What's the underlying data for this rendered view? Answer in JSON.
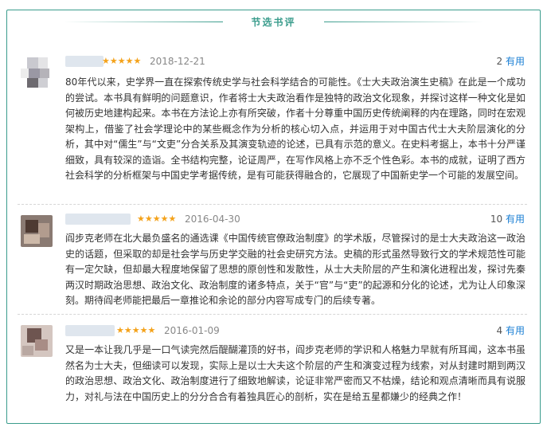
{
  "header": {
    "title": "节选书评"
  },
  "reviews": [
    {
      "user": "",
      "stars": "★★★★★",
      "date": "2018-12-21",
      "votes": "2",
      "vote_label": "有用",
      "text": "80年代以来，史学界一直在探索传统史学与社会科学结合的可能性。《士大夫政治演生史稿》在此是一个成功的尝试。本书具有鲜明的问题意识，作者将士大夫政治看作是独特的政治文化现象，并探讨这样一种文化是如何被历史地建构起来。本书在方法论上亦有所突破，作者十分尊重中国历史传统阐释的内在理路，同时在宏观架构上，借鉴了社会学理论中的某些概念作为分析的核心切入点，并运用于对中国古代士大夫阶层演化的分析，其中对“儒生”与“文吏”分合关系及其演变轨迹的论述，已具有示范的意义。在史料考据上，本书十分严谨细致，具有较深的造诣。全书结构完整，论证周严，在写作风格上亦不乏个性色彩。本书的成就，证明了西方社会科学的分析框架与中国史学考据传统，是有可能获得融合的，它展现了中国新史学一个可能的发展空间。"
    },
    {
      "user": "",
      "stars": "★★★★★",
      "date": "2016-04-30",
      "votes": "10",
      "vote_label": "有用",
      "text": "阎步克老师在北大最负盛名的通选课《中国传统官僚政治制度》的学术版，尽管探讨的是士大夫政治这一政治史的话题，但采取的却是社会学与历史学交融的社会史研究方法。史稿的形式虽然导致行文的学术规范性可能有一定欠缺，但却最大程度地保留了思想的原创性和发散性，从士大夫阶层的产生和演化进程出发，探讨先秦两汉时期政治思想、政治文化、政治制度的诸多特点，关于“官”与“吏”的起源和分化的论述，尤为让人印象深刻。期待阎老师能把最后一章推论和余论的部分内容写成专门的后续专著。"
    },
    {
      "user": "",
      "stars": "★★★★★",
      "date": "2016-01-09",
      "votes": "4",
      "vote_label": "有用",
      "text": "又是一本让我几乎是一口气读完然后醍醐灌顶的好书，阎步克老师的学识和人格魅力早就有所耳闻，这本书虽然名为士大夫，但细读可以发现，实际上是以士大夫这个阶层的产生和演变过程为线索，对从封建时期到两汉的政治思想、政治文化、政治制度进行了细致地解读，论证非常严密而又不枯燥，结论和观点清晰而具有说服力，对礼与法在中国历史上的分分合合有着独具匠心的剖析，实在是给五星都嫌少的经典之作！"
    }
  ],
  "colors": {
    "accent": "#3a9c8c",
    "star": "#f4a21a",
    "vote_label": "#1a7fd4"
  }
}
